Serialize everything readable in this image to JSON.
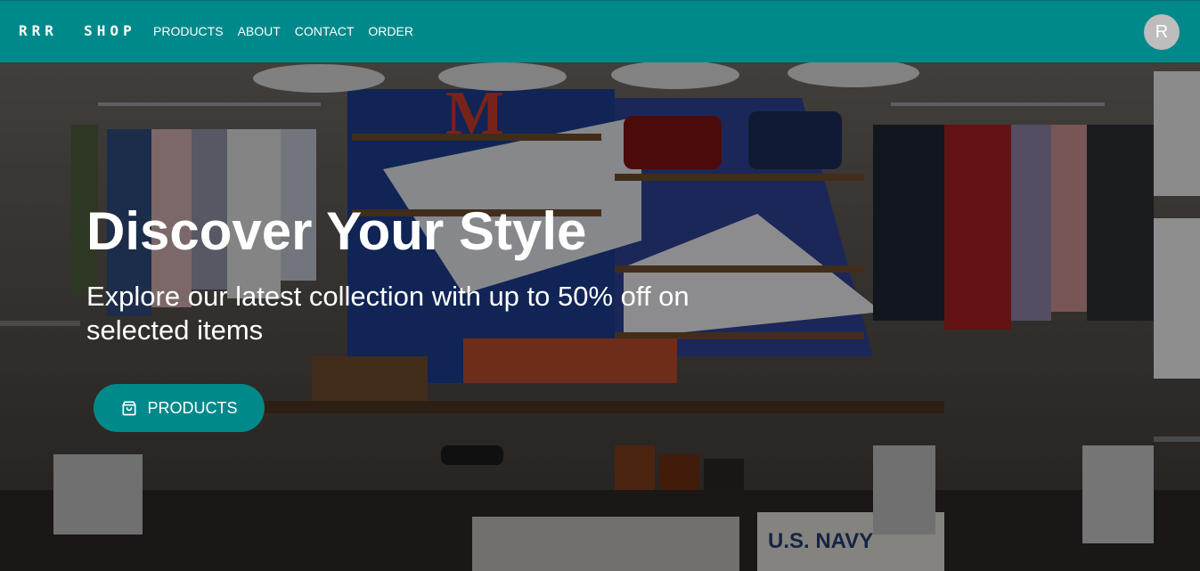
{
  "brand": {
    "name": "RRR  SHOP"
  },
  "nav": {
    "links": [
      {
        "label": "PRODUCTS"
      },
      {
        "label": "ABOUT"
      },
      {
        "label": "CONTACT"
      },
      {
        "label": "ORDER"
      }
    ]
  },
  "user": {
    "avatar_initial": "R"
  },
  "hero": {
    "title": "Discover Your Style",
    "subtitle": "Explore our latest collection with up to 50% off on selected items",
    "cta_label": "PRODUCTS",
    "cta_icon": "shopping-bag-icon"
  },
  "colors": {
    "primary": "#00898a",
    "avatar": "#bdbdbd",
    "text": "#ffffff"
  }
}
